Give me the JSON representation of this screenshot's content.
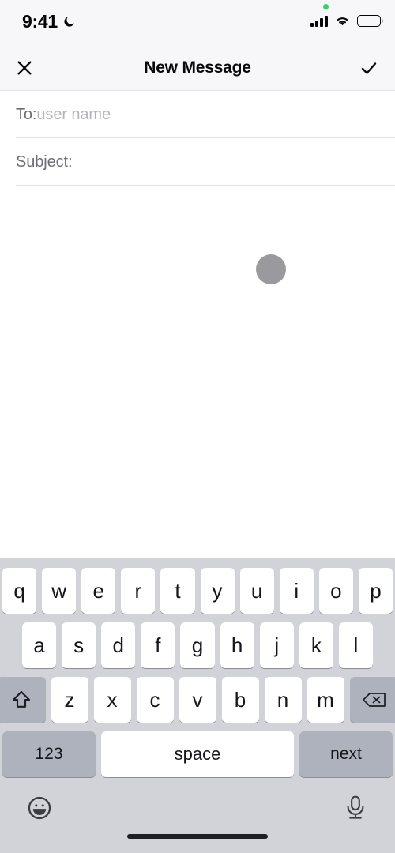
{
  "status_bar": {
    "time": "9:41",
    "dnd_icon": "crescent-moon-icon",
    "signal_icon": "cellular-signal-icon",
    "wifi_icon": "wifi-icon",
    "battery_icon": "battery-full-icon",
    "privacy_dot": "green-recording-dot"
  },
  "nav_bar": {
    "close_icon": "close-x-icon",
    "title": "New Message",
    "done_icon": "checkmark-icon"
  },
  "fields": {
    "to": {
      "label": "To:",
      "placeholder": "user name",
      "value": ""
    },
    "subject": {
      "label": "Subject:",
      "placeholder": "",
      "value": ""
    }
  },
  "compose_body": {
    "indicator": "gray-circle-indicator",
    "value": ""
  },
  "keyboard": {
    "row1": [
      "q",
      "w",
      "e",
      "r",
      "t",
      "y",
      "u",
      "i",
      "o",
      "p"
    ],
    "row2": [
      "a",
      "s",
      "d",
      "f",
      "g",
      "h",
      "j",
      "k",
      "l"
    ],
    "row3": [
      "z",
      "x",
      "c",
      "v",
      "b",
      "n",
      "m"
    ],
    "shift_icon": "shift-arrow-icon",
    "backspace_icon": "backspace-delete-icon",
    "numbers_label": "123",
    "space_label": "space",
    "return_label": "next",
    "emoji_icon": "emoji-smiley-icon",
    "dictation_icon": "microphone-icon"
  },
  "home_indicator": "home-indicator-bar",
  "colors": {
    "keyboard_bg": "#d1d3d9",
    "key_white": "#ffffff",
    "key_gray": "#aeb2bd",
    "nav_bg": "#f7f7fa",
    "label_gray": "#6e6e73",
    "placeholder_gray": "#b4b4b9",
    "dot_gray": "#9a9a9e",
    "privacy_green": "#3ad06a"
  }
}
